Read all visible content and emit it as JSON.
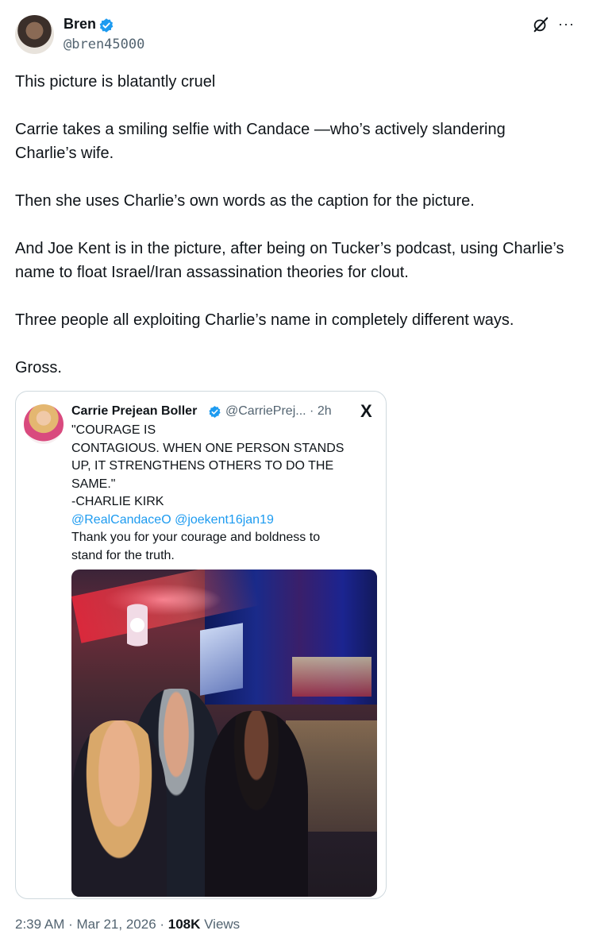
{
  "author": {
    "name": "Bren",
    "handle": "@bren45000"
  },
  "tweet": {
    "paragraphs": [
      "This picture is blatantly cruel",
      "Carrie takes a smiling selfie with Candace —who’s actively slandering Charlie’s wife.",
      "Then she uses Charlie’s own words as the caption for the picture.",
      "And Joe Kent is in the picture, after being on Tucker’s podcast, using Charlie’s name to float Israel/Iran assassination theories for clout.",
      "Three people all exploiting Charlie’s name in completely different ways.",
      "Gross."
    ]
  },
  "quote": {
    "name": "Carrie Prejean Boller",
    "handle_time": "@CarriePrej... · 2h",
    "lines": [
      "\"COURAGE IS",
      "CONTAGIOUS. WHEN ONE PERSON STANDS",
      "UP, IT STRENGTHENS OTHERS TO DO THE",
      "SAME.\"",
      "-CHARLIE KIRK"
    ],
    "mentions": "@RealCandaceO @joekent16jan19",
    "closing": [
      "Thank you for your courage and boldness to",
      "stand for the truth."
    ],
    "x_logo": "X"
  },
  "footer": {
    "time": "2:39 AM · Mar 21, 2026 · ",
    "views_count": "108K",
    "views_label": " Views"
  },
  "icons": {
    "more": "···",
    "accent": "#1d9bf0"
  }
}
